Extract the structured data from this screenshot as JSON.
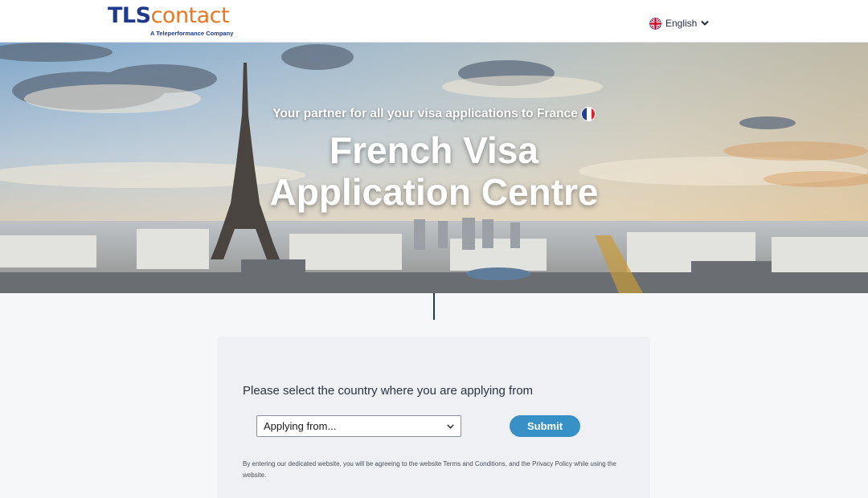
{
  "header": {
    "logo_main_tls": "TLS",
    "logo_main_contact": "contact",
    "logo_sub": "A Teleperformance Company",
    "language_label": "English"
  },
  "hero": {
    "tagline": "Your partner for all your visa applications to France",
    "title_line1": "French Visa",
    "title_line2": "Application Centre"
  },
  "form": {
    "prompt": "Please select the country where you are applying from",
    "select_value": "Applying from...",
    "submit_label": "Submit",
    "disclaimer": "By entering our dedicated website, you will be agreeing to the website Terms and Conditions, and the Privacy Policy while using the website."
  },
  "colors": {
    "brand_blue": "#1f3a8a",
    "brand_orange": "#e87722",
    "submit_blue": "#3891c6"
  }
}
